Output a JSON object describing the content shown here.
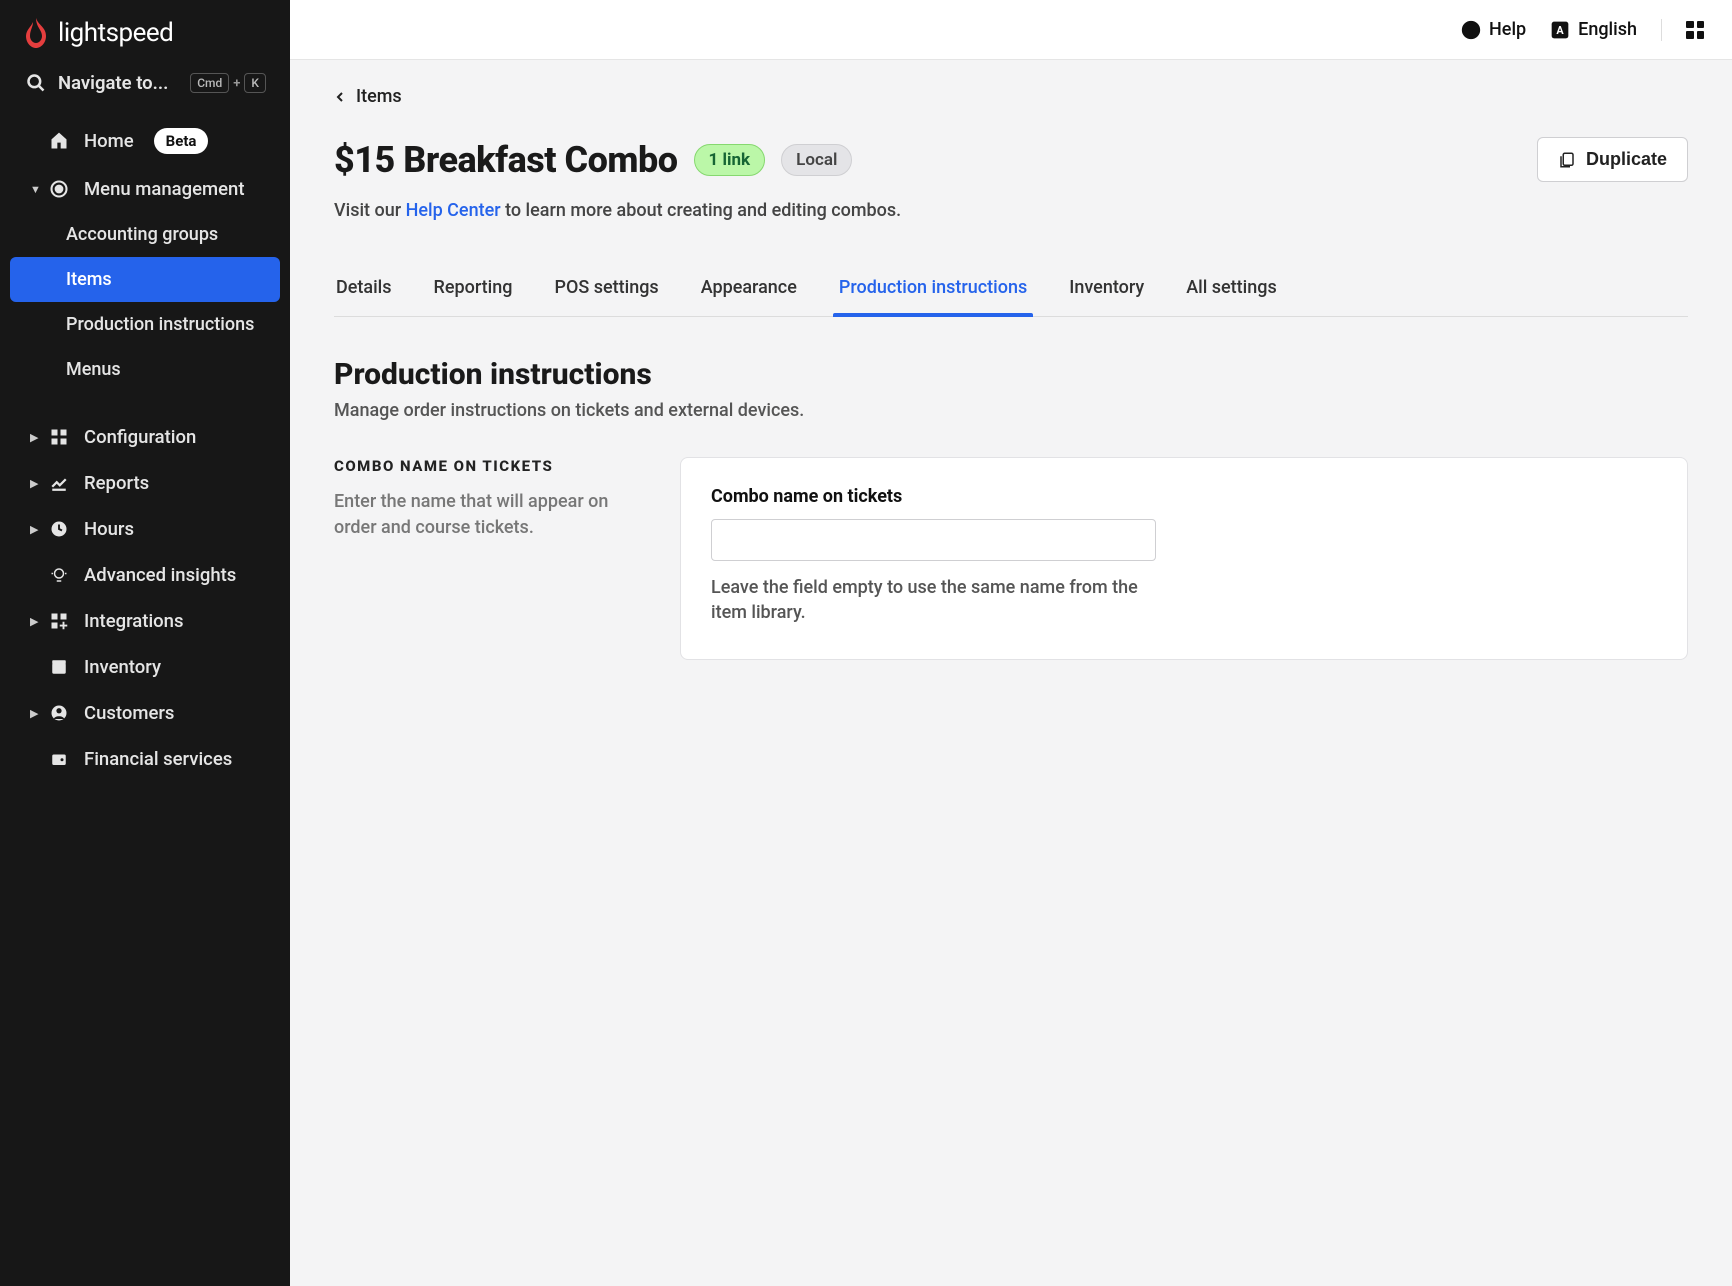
{
  "brand": {
    "name": "lightspeed"
  },
  "search": {
    "label": "Navigate to...",
    "kbd1": "Cmd",
    "kbd2": "K"
  },
  "sidebar": {
    "home": "Home",
    "home_badge": "Beta",
    "menu_management": "Menu management",
    "accounting_groups": "Accounting groups",
    "items": "Items",
    "production_instructions": "Production instructions",
    "menus": "Menus",
    "configuration": "Configuration",
    "reports": "Reports",
    "hours": "Hours",
    "advanced_insights": "Advanced insights",
    "integrations": "Integrations",
    "inventory": "Inventory",
    "customers": "Customers",
    "financial_services": "Financial services"
  },
  "topbar": {
    "help": "Help",
    "language": "English"
  },
  "breadcrumb": {
    "items": "Items"
  },
  "page": {
    "title": "$15 Breakfast Combo",
    "link_badge": "1 link",
    "local_badge": "Local",
    "duplicate": "Duplicate",
    "visit_prefix": "Visit our ",
    "help_center": "Help Center",
    "visit_suffix": " to learn more about creating and editing combos."
  },
  "tabs": {
    "details": "Details",
    "reporting": "Reporting",
    "pos_settings": "POS settings",
    "appearance": "Appearance",
    "production_instructions": "Production instructions",
    "inventory": "Inventory",
    "all_settings": "All settings"
  },
  "section": {
    "title": "Production instructions",
    "subtitle": "Manage order instructions on tickets and external devices."
  },
  "field": {
    "left_label": "COMBO NAME ON TICKETS",
    "left_help": "Enter the name that will appear on order and course tickets.",
    "card_label": "Combo name on tickets",
    "card_value": "",
    "card_hint": "Leave the field empty to use the same name from the item library."
  }
}
